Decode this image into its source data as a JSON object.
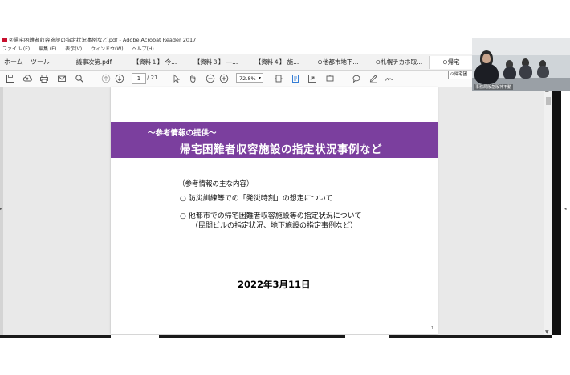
{
  "window": {
    "title": "②帰宅困難者収容施設の指定状況事例など.pdf - Adobe Acrobat Reader 2017"
  },
  "menubar": [
    "ファイル (F)",
    "編集 (E)",
    "表示(V)",
    "ウィンドウ(W)",
    "ヘルプ(H)"
  ],
  "nav": {
    "home": "ホーム",
    "tools": "ツール"
  },
  "tabs": [
    "議事次第.pdf",
    "【資料１】 今...",
    "【資料３】 —...",
    "【資料４】 施...",
    "⊙他都市地下...",
    "⊙札幌チカホ取...",
    "⊙帰宅"
  ],
  "toolbar": {
    "current_page": "1",
    "page_total": "/ 21",
    "zoom": "72.8%"
  },
  "tooltip": "⊙帰宅困",
  "document": {
    "banner_subtitle": "〜参考情報の提供〜",
    "banner_title": "帰宅困難者収容施設の指定状況事例など",
    "contents_header": "（参考情報の主な内容）",
    "item1": "○ 防災訓練等での「発災時刻」の想定について",
    "item2": "○ 他都市での帰宅困難者収容施設等の指定状況について",
    "item2_sub": "（民間ビルの指定状況、地下施設の指定事例など）",
    "date": "2022年3月11日",
    "page_number": "1"
  },
  "video": {
    "label": "事務局阪急阪神不動"
  },
  "colors": {
    "banner": "#7b3f9e",
    "tabbar": "#f2f2f2"
  }
}
